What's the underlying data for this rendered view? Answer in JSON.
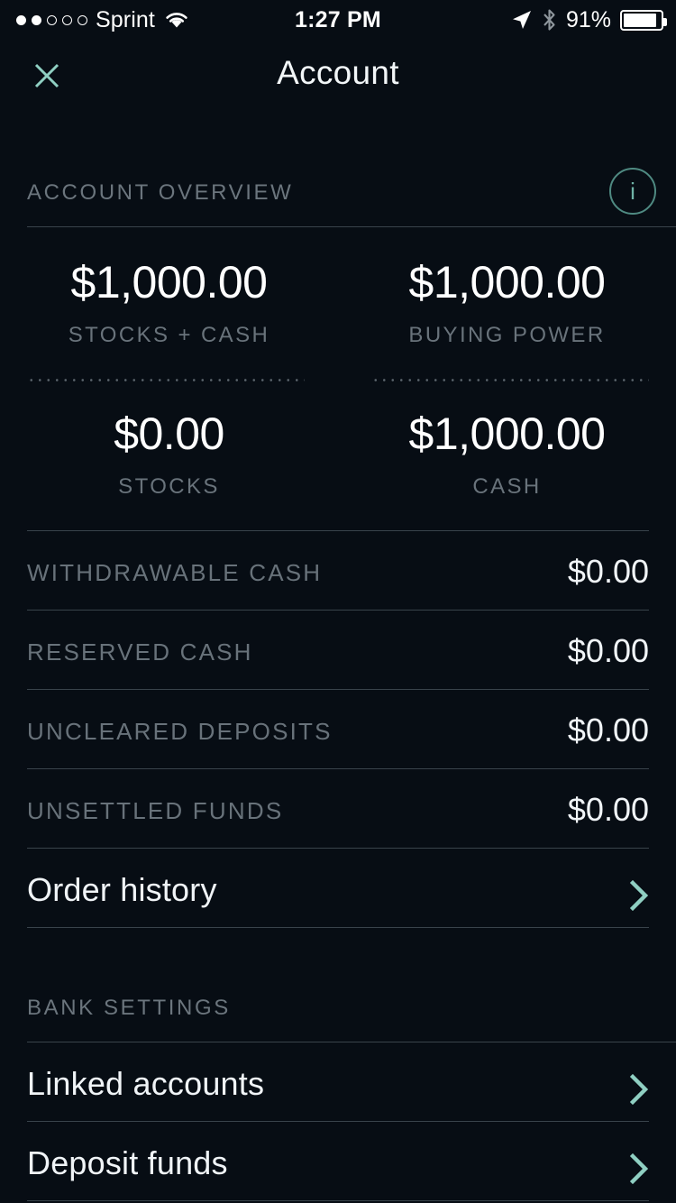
{
  "status_bar": {
    "signal_dots_total": 5,
    "signal_dots_filled": 2,
    "carrier": "Sprint",
    "wifi_icon": "wifi-icon",
    "time": "1:27 PM",
    "location_icon": "location-arrow-icon",
    "bluetooth_icon": "bluetooth-icon",
    "battery_percent": "91%"
  },
  "nav": {
    "close_icon": "close-icon",
    "title": "Account"
  },
  "account_overview": {
    "section_label": "ACCOUNT OVERVIEW",
    "info_icon": "info-icon",
    "info_glyph": "i",
    "summary": [
      {
        "amount": "$1,000.00",
        "label": "STOCKS + CASH"
      },
      {
        "amount": "$1,000.00",
        "label": "BUYING POWER"
      },
      {
        "amount": "$0.00",
        "label": "STOCKS"
      },
      {
        "amount": "$1,000.00",
        "label": "CASH"
      }
    ],
    "rows": [
      {
        "label": "WITHDRAWABLE CASH",
        "value": "$0.00"
      },
      {
        "label": "RESERVED CASH",
        "value": "$0.00"
      },
      {
        "label": "UNCLEARED DEPOSITS",
        "value": "$0.00"
      },
      {
        "label": "UNSETTLED FUNDS",
        "value": "$0.00"
      }
    ],
    "order_history": {
      "label": "Order history",
      "chevron_icon": "chevron-right-icon"
    }
  },
  "bank_settings": {
    "section_label": "BANK SETTINGS",
    "rows": [
      {
        "label": "Linked accounts",
        "chevron_icon": "chevron-right-icon"
      },
      {
        "label": "Deposit funds",
        "chevron_icon": "chevron-right-icon"
      }
    ]
  },
  "colors": {
    "background": "#070d14",
    "accent_teal": "#8fcfc2",
    "text_primary": "#f0f4f7",
    "text_muted": "#68727a",
    "divider": "#39434b"
  }
}
